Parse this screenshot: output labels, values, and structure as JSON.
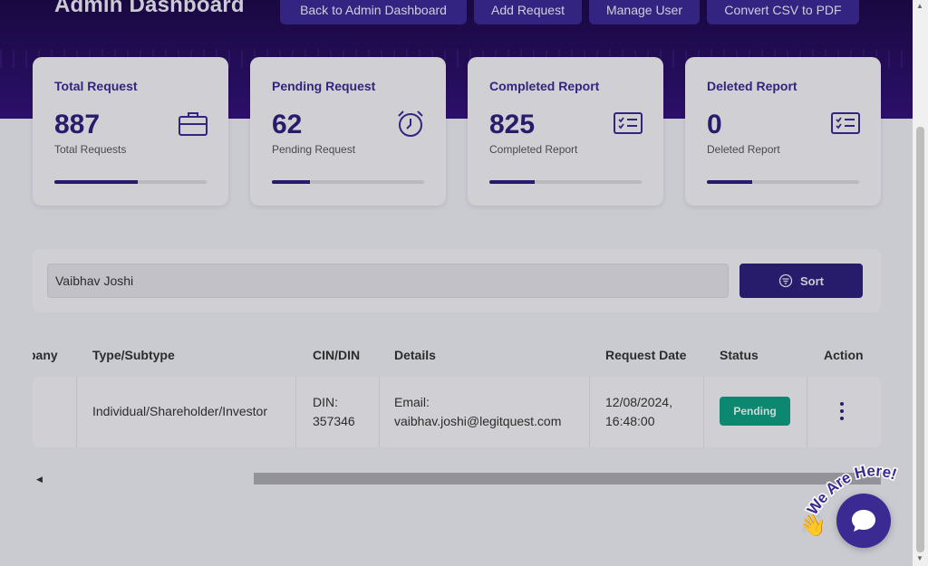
{
  "header": {
    "title": "Admin Dashboard",
    "buttons": [
      {
        "label": "Back to Admin Dashboard"
      },
      {
        "label": "Add Request"
      },
      {
        "label": "Manage User"
      },
      {
        "label": "Convert CSV to PDF"
      }
    ]
  },
  "stats": [
    {
      "title": "Total Request",
      "value": "887",
      "subtitle": "Total Requests",
      "icon": "briefcase-icon",
      "progress": 0.55
    },
    {
      "title": "Pending Request",
      "value": "62",
      "subtitle": "Pending Request",
      "icon": "alarm-clock-icon",
      "progress": 0.25
    },
    {
      "title": "Completed Report",
      "value": "825",
      "subtitle": "Completed Report",
      "icon": "checklist-icon",
      "progress": 0.3
    },
    {
      "title": "Deleted Report",
      "value": "0",
      "subtitle": "Deleted Report",
      "icon": "checklist-icon",
      "progress": 0.3
    }
  ],
  "search": {
    "value": "Vaibhav Joshi",
    "sort_label": "Sort"
  },
  "table": {
    "columns": [
      "pany",
      "Type/Subtype",
      "CIN/DIN",
      "Details",
      "Request Date",
      "Status",
      "Action"
    ],
    "rows": [
      {
        "company": "",
        "type": "Individual/Shareholder/Investor",
        "din_line1": "DIN:",
        "din_line2": "357346",
        "details_line1": "Email:",
        "details_line2": "vaibhav.joshi@legitquest.com",
        "date_line1": "12/08/2024,",
        "date_line2": "16:48:00",
        "status": "Pending"
      }
    ]
  },
  "chat": {
    "label": "We Are Here!"
  },
  "colors": {
    "primary": "#2d1f7a",
    "status_pending": "#0e9a80",
    "hero": "#2a0f66"
  }
}
